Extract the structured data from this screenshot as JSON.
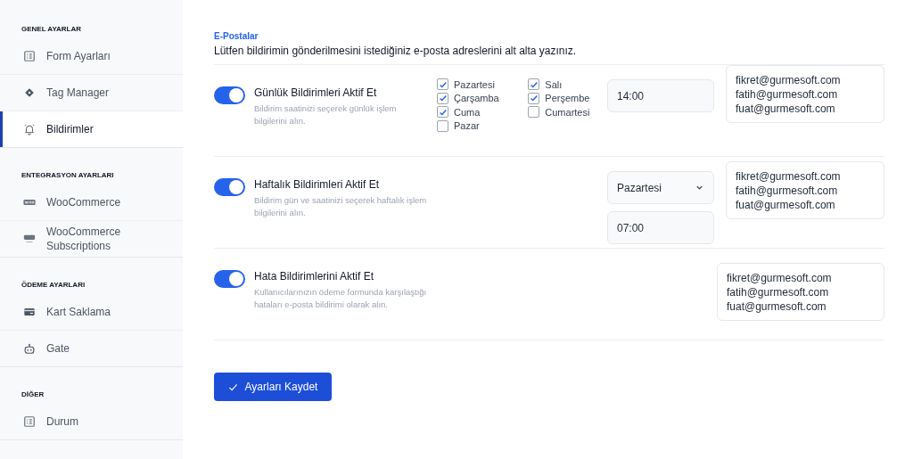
{
  "sidebar": {
    "sections": [
      {
        "heading": "GENEL AYARLAR",
        "items": [
          {
            "label": "Form Ayarları",
            "selected": false
          },
          {
            "label": "Tag Manager",
            "selected": false
          },
          {
            "label": "Bildirimler",
            "selected": true
          }
        ]
      },
      {
        "heading": "ENTEGRASYON AYARLARI",
        "items": [
          {
            "label": "WooCommerce",
            "selected": false
          },
          {
            "label": "WooCommerce Subscriptions",
            "selected": false
          }
        ]
      },
      {
        "heading": "ÖDEME AYARLARI",
        "items": [
          {
            "label": "Kart Saklama",
            "selected": false
          },
          {
            "label": "Gate",
            "selected": false
          }
        ]
      },
      {
        "heading": "DİĞER",
        "items": [
          {
            "label": "Durum",
            "selected": false
          }
        ]
      }
    ]
  },
  "section": {
    "title": "E-Postalar",
    "description": "Lütfen bildirimin gönderilmesini istediğiniz e-posta adreslerini alt alta yazınız."
  },
  "notifications": [
    {
      "kind": "daily",
      "title": "Günlük Bildirimleri Aktif Et",
      "description": "Bildirim saatinizi seçerek günlük işlem bilgilerini alın.",
      "on": true,
      "days": [
        {
          "label": "Pazartesi",
          "checked": true
        },
        {
          "label": "Çarşamba",
          "checked": true
        },
        {
          "label": "Cuma",
          "checked": true
        },
        {
          "label": "Pazar",
          "checked": false
        },
        {
          "label": "Salı",
          "checked": true
        },
        {
          "label": "Perşembe",
          "checked": true
        },
        {
          "label": "Cumartesi",
          "checked": false
        }
      ],
      "time": "14:00",
      "emails": [
        "fikret@gurmesoft.com",
        "fatih@gurmesoft.com",
        "fuat@gurmesoft.com"
      ]
    },
    {
      "kind": "weekly",
      "title": "Haftalık Bildirimleri Aktif Et",
      "description": "Bildirim gün ve saatinizi seçerek haftalık işlem bilgilerini alın.",
      "on": true,
      "day": "Pazartesi",
      "time": "07:00",
      "emails": [
        "fikret@gurmesoft.com",
        "fatih@gurmesoft.com",
        "fuat@gurmesoft.com"
      ]
    },
    {
      "kind": "error",
      "title": "Hata Bildirimlerini Aktif Et",
      "description": "Kullanıcılarınızın ödeme formunda karşılaştığı hataları e-posta bildirimi olarak alın.",
      "on": true,
      "emails": [
        "fikret@gurmesoft.com",
        "fatih@gurmesoft.com",
        "fuat@gurmesoft.com"
      ]
    }
  ],
  "save_button": "Ayarları Kaydet"
}
